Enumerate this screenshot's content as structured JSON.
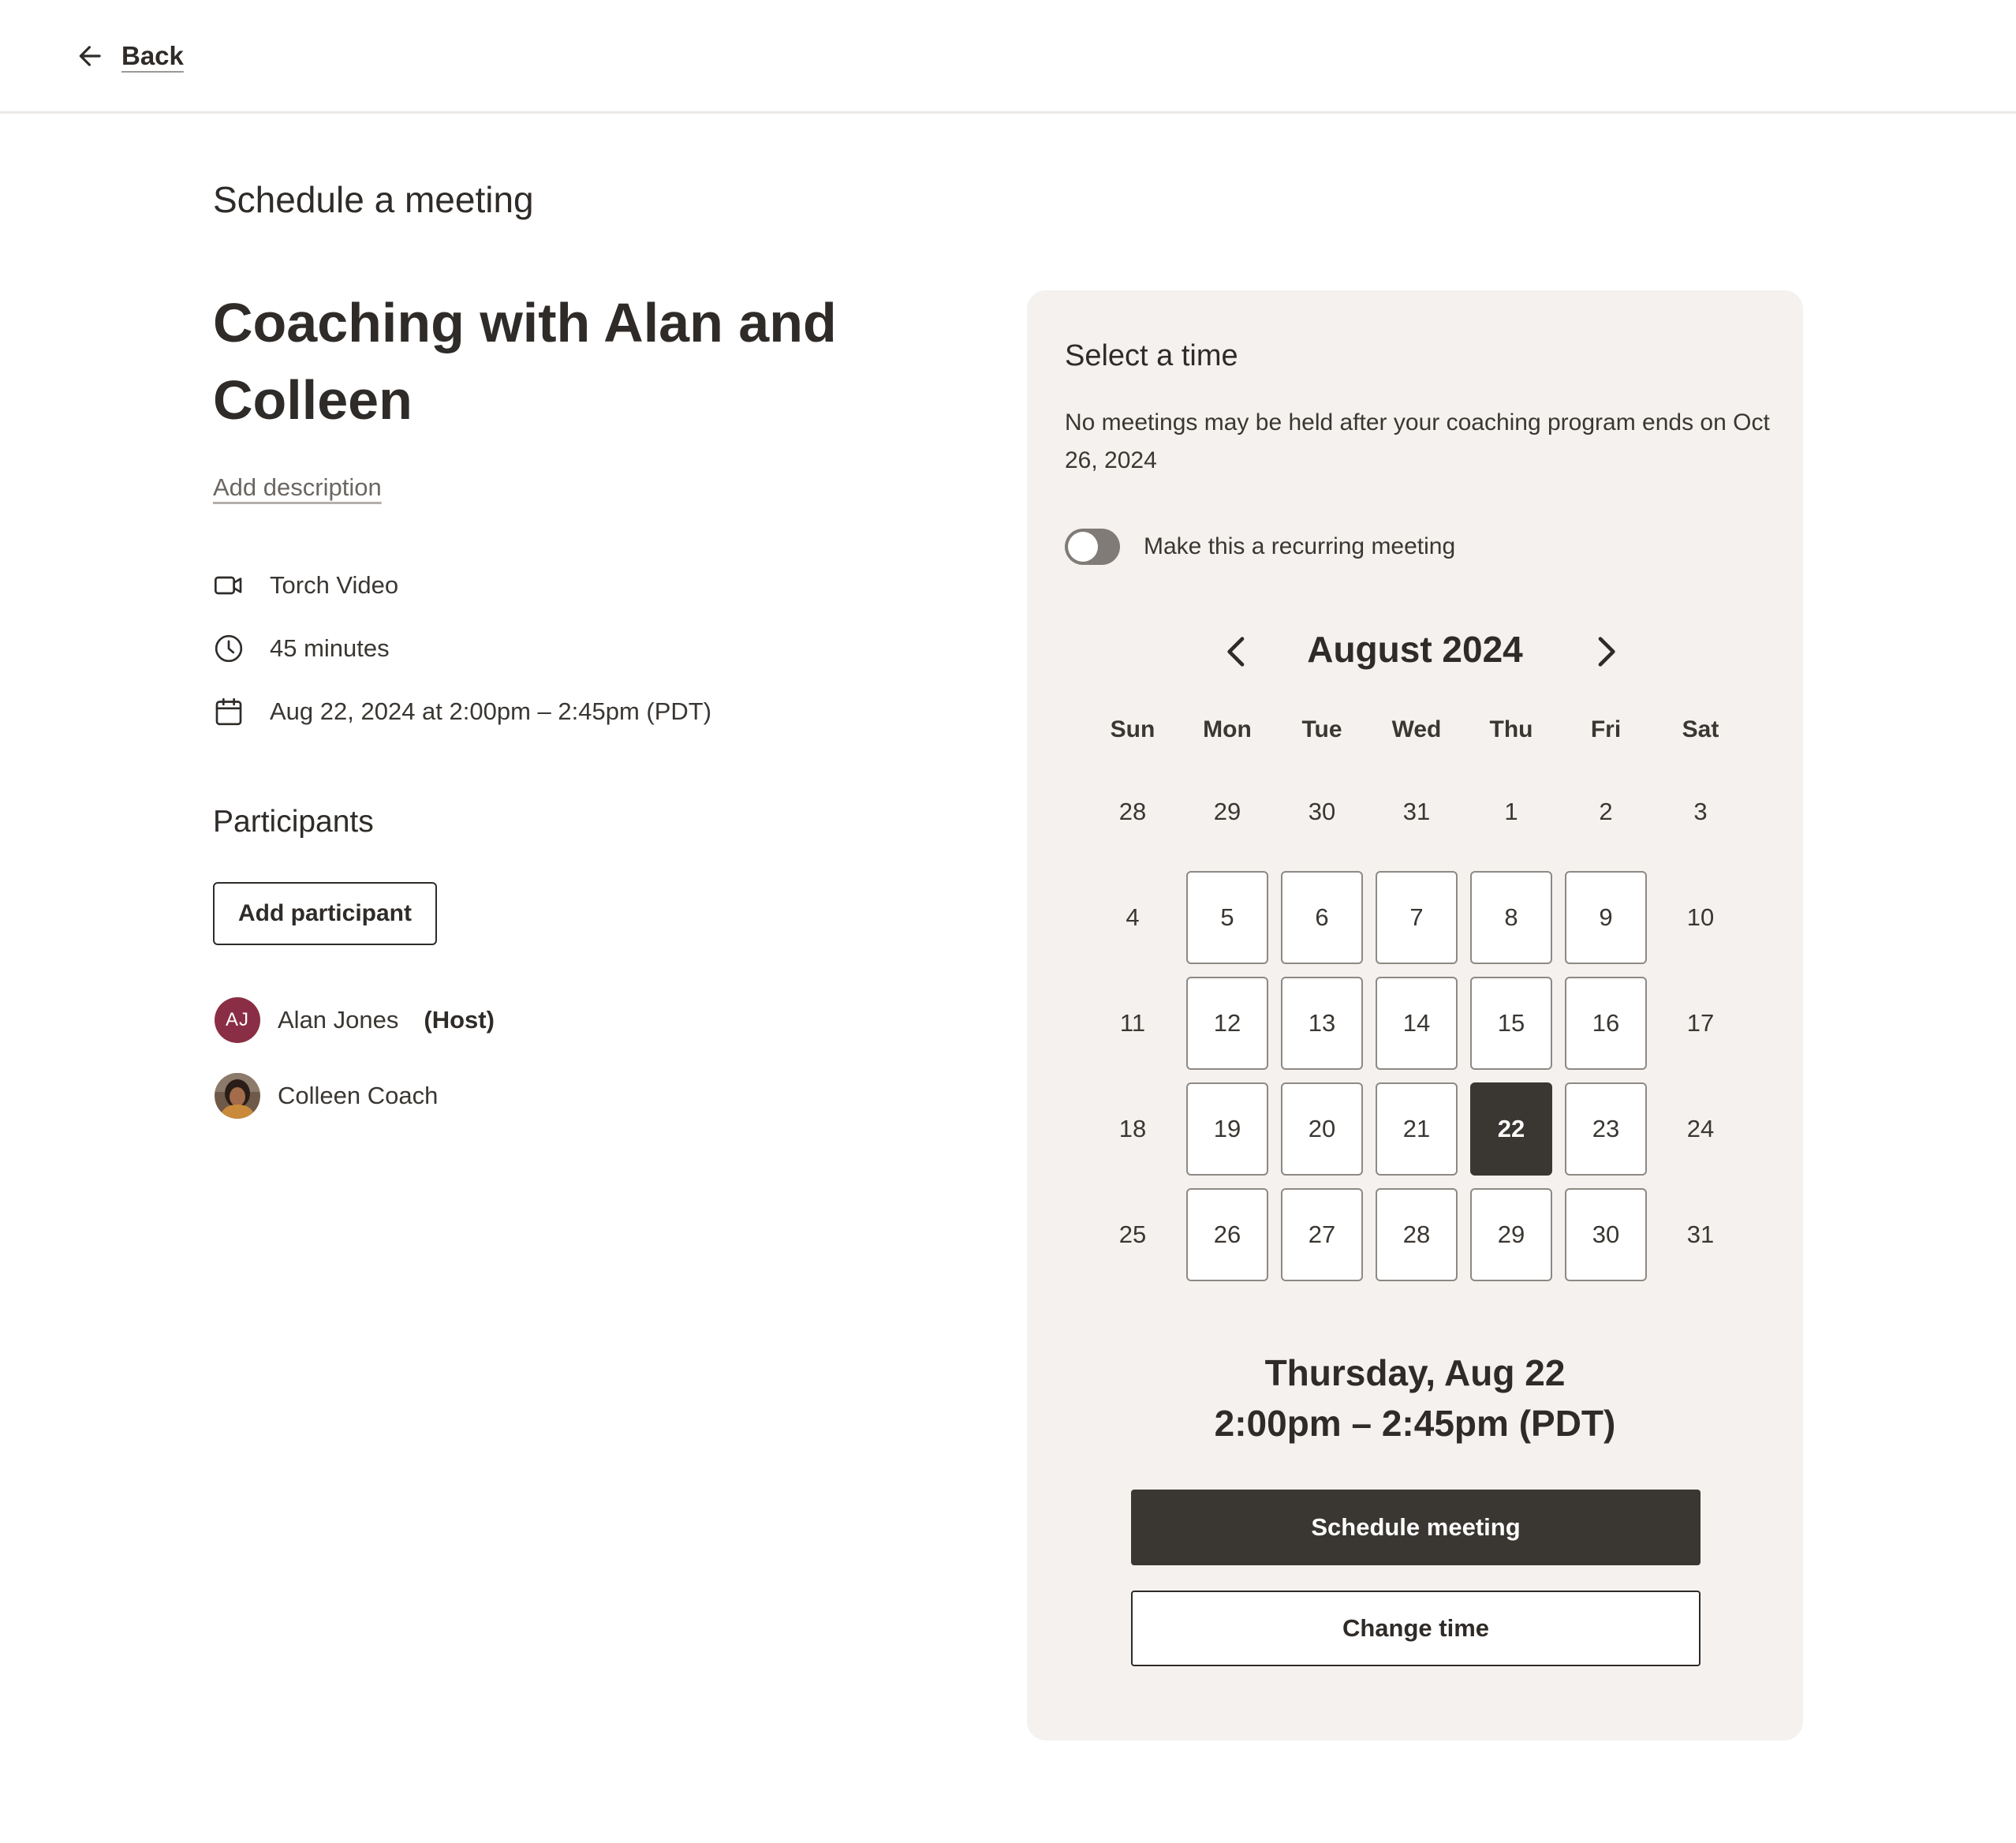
{
  "nav": {
    "back_label": "Back"
  },
  "page_title": "Schedule a meeting",
  "meeting": {
    "title": "Coaching with Alan and Colleen",
    "add_description": "Add description",
    "details": [
      {
        "icon": "video-camera-icon",
        "text": "Torch Video"
      },
      {
        "icon": "clock-icon",
        "text": "45 minutes"
      },
      {
        "icon": "calendar-icon",
        "text": "Aug 22, 2024 at 2:00pm – 2:45pm (PDT)"
      }
    ]
  },
  "participants": {
    "title": "Participants",
    "add_button": "Add participant",
    "list": [
      {
        "initials": "AJ",
        "name": "Alan Jones",
        "role": "(Host)",
        "avatar_color": "#8a2e45"
      },
      {
        "initials": "",
        "name": "Colleen Coach",
        "role": "",
        "avatar": "photo"
      }
    ]
  },
  "time_panel": {
    "title": "Select a time",
    "note": "No meetings may be held after your coaching program ends on Oct 26, 2024",
    "recurring_label": "Make this a recurring meeting",
    "recurring_on": false,
    "calendar": {
      "month_label": "August 2024",
      "weekdays": [
        "Sun",
        "Mon",
        "Tue",
        "Wed",
        "Thu",
        "Fri",
        "Sat"
      ],
      "weeks": [
        [
          {
            "d": "28",
            "s": "plain"
          },
          {
            "d": "29",
            "s": "plain"
          },
          {
            "d": "30",
            "s": "plain"
          },
          {
            "d": "31",
            "s": "plain"
          },
          {
            "d": "1",
            "s": "plain"
          },
          {
            "d": "2",
            "s": "plain"
          },
          {
            "d": "3",
            "s": "plain"
          }
        ],
        [
          {
            "d": "4",
            "s": "plain"
          },
          {
            "d": "5",
            "s": "available"
          },
          {
            "d": "6",
            "s": "available"
          },
          {
            "d": "7",
            "s": "available"
          },
          {
            "d": "8",
            "s": "available"
          },
          {
            "d": "9",
            "s": "available"
          },
          {
            "d": "10",
            "s": "plain"
          }
        ],
        [
          {
            "d": "11",
            "s": "plain"
          },
          {
            "d": "12",
            "s": "available"
          },
          {
            "d": "13",
            "s": "available"
          },
          {
            "d": "14",
            "s": "available"
          },
          {
            "d": "15",
            "s": "available"
          },
          {
            "d": "16",
            "s": "available"
          },
          {
            "d": "17",
            "s": "plain"
          }
        ],
        [
          {
            "d": "18",
            "s": "plain"
          },
          {
            "d": "19",
            "s": "available"
          },
          {
            "d": "20",
            "s": "available"
          },
          {
            "d": "21",
            "s": "available"
          },
          {
            "d": "22",
            "s": "selected"
          },
          {
            "d": "23",
            "s": "available"
          },
          {
            "d": "24",
            "s": "plain"
          }
        ],
        [
          {
            "d": "25",
            "s": "plain"
          },
          {
            "d": "26",
            "s": "available"
          },
          {
            "d": "27",
            "s": "available"
          },
          {
            "d": "28",
            "s": "available"
          },
          {
            "d": "29",
            "s": "available"
          },
          {
            "d": "30",
            "s": "available"
          },
          {
            "d": "31",
            "s": "plain"
          }
        ]
      ]
    },
    "selected_date": "Thursday, Aug 22",
    "selected_time": "2:00pm – 2:45pm (PDT)",
    "schedule_button": "Schedule meeting",
    "change_button": "Change time"
  },
  "colors": {
    "text": "#2f2b28",
    "panel_bg": "#f4f1ee",
    "primary": "#3a3632",
    "avatar_aj": "#8a2e45"
  }
}
